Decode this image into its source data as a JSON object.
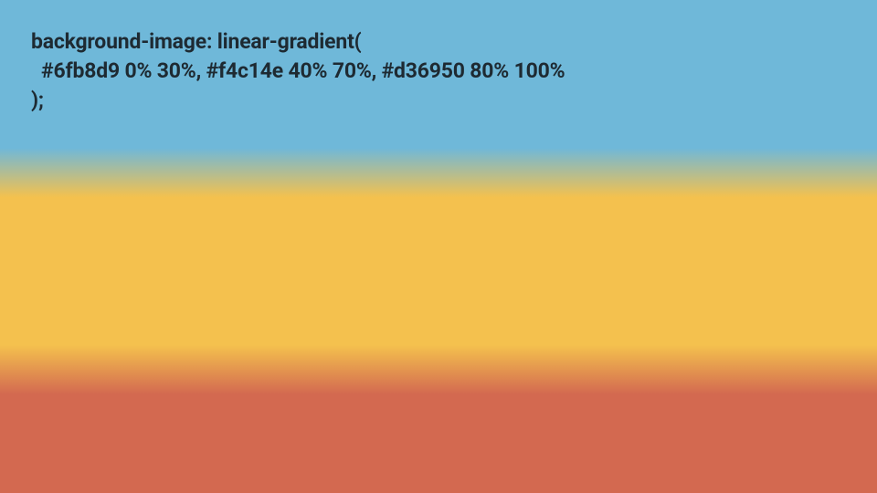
{
  "code": {
    "line1": "background-image: linear-gradient(",
    "line2": "  #6fb8d9 0% 30%, #f4c14e 40% 70%, #d36950 80% 100%",
    "line3": ");"
  },
  "gradient": {
    "stops": [
      {
        "color": "#6fb8d9",
        "from": "0%",
        "to": "30%"
      },
      {
        "color": "#f4c14e",
        "from": "40%",
        "to": "70%"
      },
      {
        "color": "#d36950",
        "from": "80%",
        "to": "100%"
      }
    ]
  }
}
